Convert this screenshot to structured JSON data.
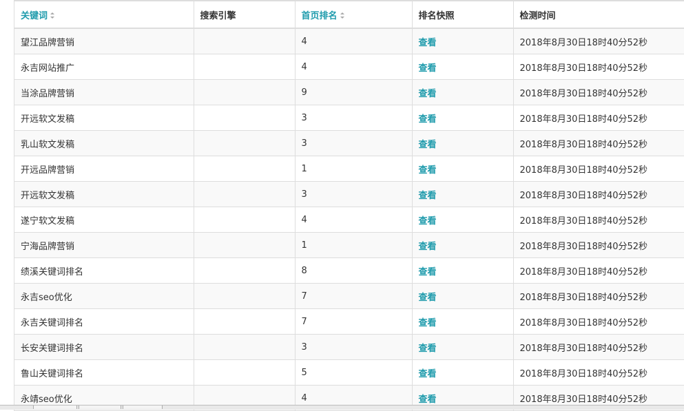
{
  "table": {
    "headers": {
      "keyword": "关键词",
      "engine": "搜索引擎",
      "rank": "首页排名",
      "snapshot": "排名快照",
      "time": "检测时间"
    },
    "rows": [
      {
        "keyword": "望江品牌营销",
        "engine": "",
        "rank": "4",
        "snapshot": "查看",
        "time": "2018年8月30日18时40分52秒"
      },
      {
        "keyword": "永吉网站推广",
        "engine": "",
        "rank": "4",
        "snapshot": "查看",
        "time": "2018年8月30日18时40分52秒"
      },
      {
        "keyword": "当涂品牌营销",
        "engine": "",
        "rank": "9",
        "snapshot": "查看",
        "time": "2018年8月30日18时40分52秒"
      },
      {
        "keyword": "开远软文发稿",
        "engine": "",
        "rank": "3",
        "snapshot": "查看",
        "time": "2018年8月30日18时40分52秒"
      },
      {
        "keyword": "乳山软文发稿",
        "engine": "",
        "rank": "3",
        "snapshot": "查看",
        "time": "2018年8月30日18时40分52秒"
      },
      {
        "keyword": "开远品牌营销",
        "engine": "",
        "rank": "1",
        "snapshot": "查看",
        "time": "2018年8月30日18时40分52秒"
      },
      {
        "keyword": "开远软文发稿",
        "engine": "",
        "rank": "3",
        "snapshot": "查看",
        "time": "2018年8月30日18时40分52秒"
      },
      {
        "keyword": "遂宁软文发稿",
        "engine": "",
        "rank": "4",
        "snapshot": "查看",
        "time": "2018年8月30日18时40分52秒"
      },
      {
        "keyword": "宁海品牌营销",
        "engine": "",
        "rank": "1",
        "snapshot": "查看",
        "time": "2018年8月30日18时40分52秒"
      },
      {
        "keyword": "绩溪关键词排名",
        "engine": "",
        "rank": "8",
        "snapshot": "查看",
        "time": "2018年8月30日18时40分52秒"
      },
      {
        "keyword": "永吉seo优化",
        "engine": "",
        "rank": "7",
        "snapshot": "查看",
        "time": "2018年8月30日18时40分52秒"
      },
      {
        "keyword": "永吉关键词排名",
        "engine": "",
        "rank": "7",
        "snapshot": "查看",
        "time": "2018年8月30日18时40分52秒"
      },
      {
        "keyword": "长安关键词排名",
        "engine": "",
        "rank": "3",
        "snapshot": "查看",
        "time": "2018年8月30日18时40分52秒"
      },
      {
        "keyword": "鲁山关键词排名",
        "engine": "",
        "rank": "5",
        "snapshot": "查看",
        "time": "2018年8月30日18时40分52秒"
      },
      {
        "keyword": "永靖seo优化",
        "engine": "",
        "rank": "4",
        "snapshot": "查看",
        "time": "2018年8月30日18时40分52秒"
      }
    ]
  },
  "colors": {
    "accent": "#1f9bac",
    "border": "#dddddd",
    "stripe": "#f9f9f9"
  }
}
